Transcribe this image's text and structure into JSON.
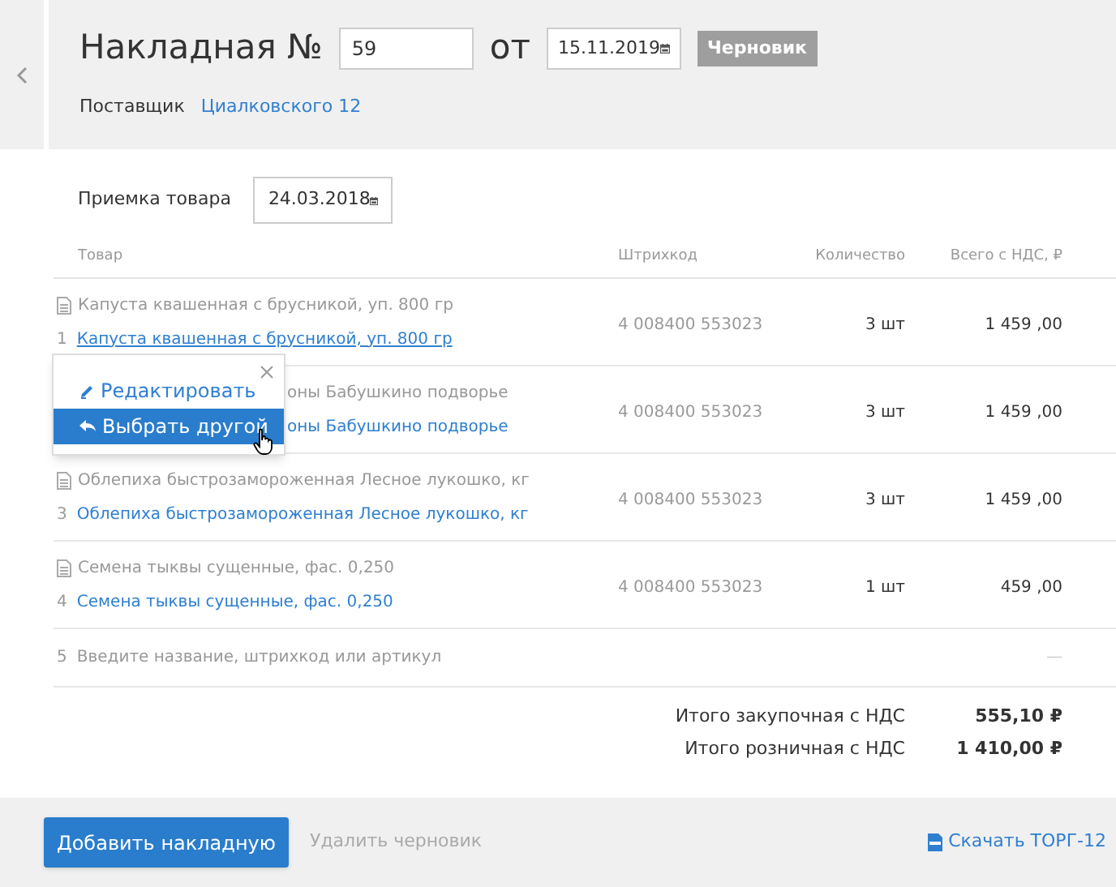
{
  "header": {
    "title": "Накладная №",
    "number": "59",
    "from_label": "от",
    "date": "15.11.2019",
    "status_badge": "Черновик",
    "supplier_label": "Поставщик",
    "supplier_link": "Циалковского 12"
  },
  "receipt": {
    "label": "Приемка товара",
    "date": "24.03.2018"
  },
  "table": {
    "columns": [
      "Товар",
      "Штрихкод",
      "Количество",
      "Всего с НДС, ₽"
    ],
    "rows": [
      {
        "index": "1",
        "source_name": "Капуста квашенная с брусникой, уп. 800 гр",
        "matched_name": "Капуста квашенная с брусникой, уп. 800 гр",
        "barcode": "4 008400 553023",
        "quantity": "3 шт",
        "total": "1 459 ,00",
        "covered": false,
        "hovered": true
      },
      {
        "source_name": "оны Бабушкино подворье",
        "matched_name": "оны Бабушкино подворье",
        "barcode": "4 008400 553023",
        "quantity": "3 шт",
        "total": "1 459 ,00",
        "covered": true,
        "hovered": false
      },
      {
        "index": "3",
        "source_name": "Облепиха быстрозамороженная Лесное лукошко, кг",
        "matched_name": "Облепиха быстрозамороженная Лесное лукошко, кг",
        "barcode": "4 008400 553023",
        "quantity": "3 шт",
        "total": "1 459 ,00",
        "covered": false,
        "hovered": false
      },
      {
        "index": "4",
        "source_name": "Семена тыквы сущенные, фас. 0,250",
        "matched_name": "Семена тыквы сущенные, фас. 0,250",
        "barcode": "4 008400 553023",
        "quantity": "1 шт",
        "total": "459 ,00",
        "covered": false,
        "hovered": false
      }
    ],
    "new_row": {
      "index": "5",
      "placeholder": "Введите название, штрихкод или артикул",
      "total": "—"
    }
  },
  "popup": {
    "items": [
      {
        "kind": "edit",
        "label": "Редактировать",
        "selected": false
      },
      {
        "kind": "replace",
        "label": "Выбрать другой",
        "selected": true
      }
    ]
  },
  "totals": [
    {
      "label": "Итого закупочная с НДС",
      "value": "555,10 ₽"
    },
    {
      "label": "Итого розничная с НДС",
      "value": "1 410,00 ₽"
    }
  ],
  "footer": {
    "primary_button": "Добавить накладную",
    "delete_link": "Удалить черновик",
    "download_link": "Скачать ТОРГ-12"
  }
}
